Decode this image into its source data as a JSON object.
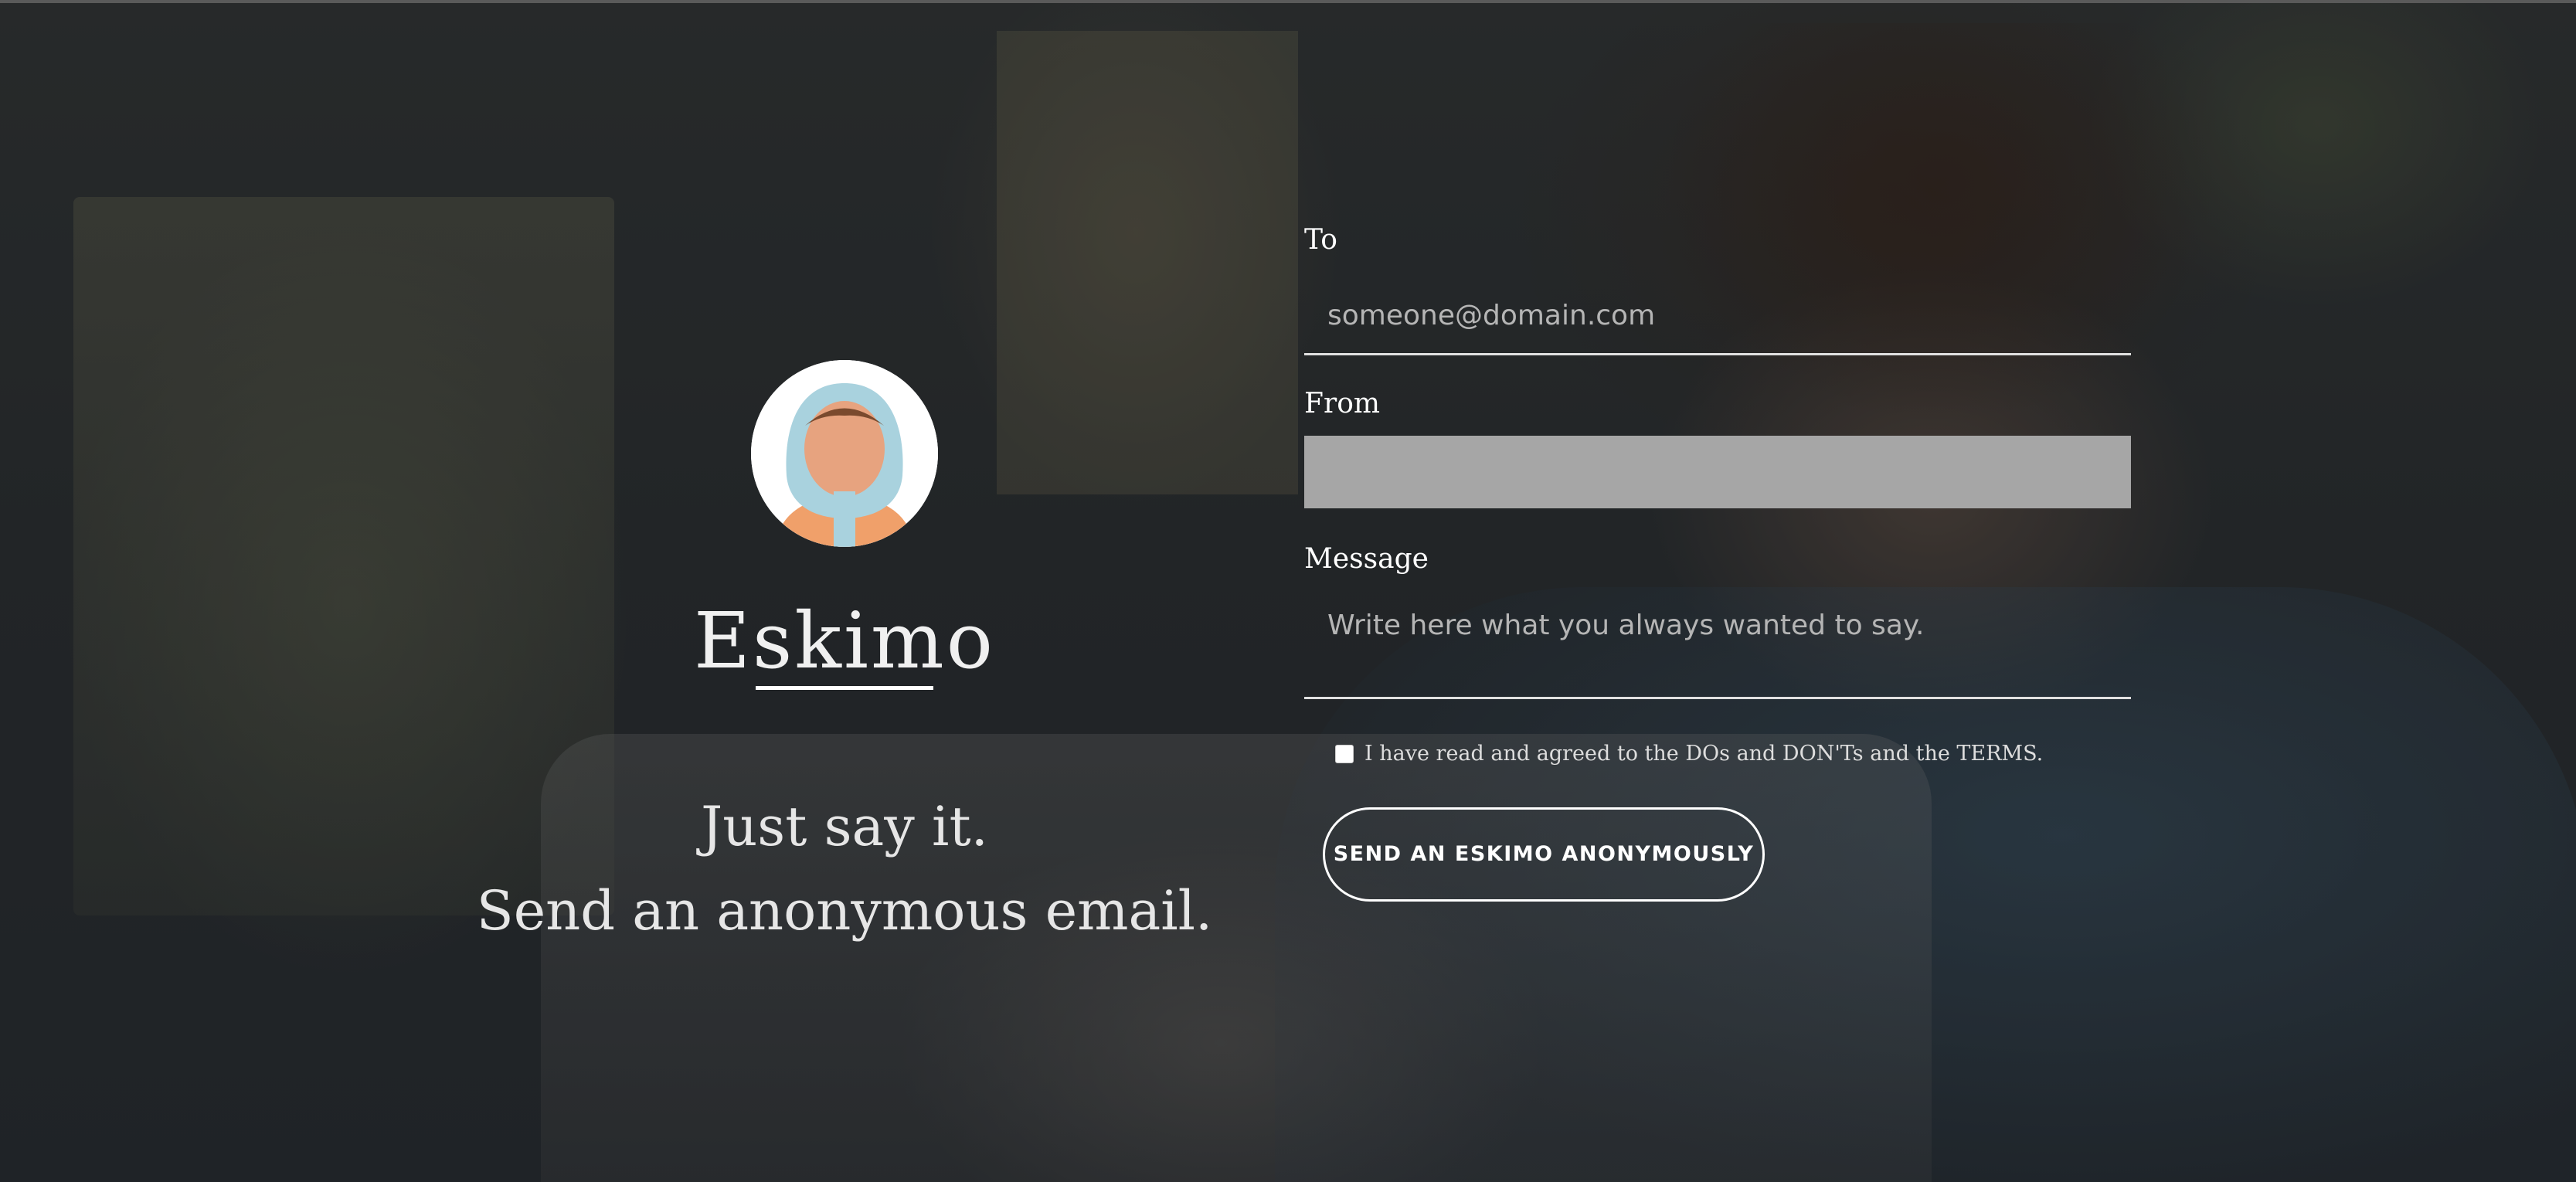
{
  "brand": {
    "name": "Eskimo",
    "tagline_line1": "Just say it.",
    "tagline_line2": "Send an anonymous email."
  },
  "form": {
    "to_label": "To",
    "to_placeholder": "someone@domain.com",
    "from_label": "From",
    "from_value": "",
    "message_label": "Message",
    "message_placeholder": "Write here what you always wanted to say.",
    "terms_checked": false,
    "terms_text": "I have read and agreed to the DOs and DON'Ts and the TERMS.",
    "submit_label": "SEND AN ESKIMO ANONYMOUSLY"
  },
  "colors": {
    "avatar_hood": "#a9d2de",
    "avatar_skin": "#e7a37f",
    "avatar_hair": "#7a4a2e",
    "avatar_shirt": "#f0a06a",
    "from_field_bg": "#a6a6a6"
  },
  "icons": {
    "avatar": "eskimo-avatar-icon",
    "checkbox": "checkbox-icon"
  }
}
